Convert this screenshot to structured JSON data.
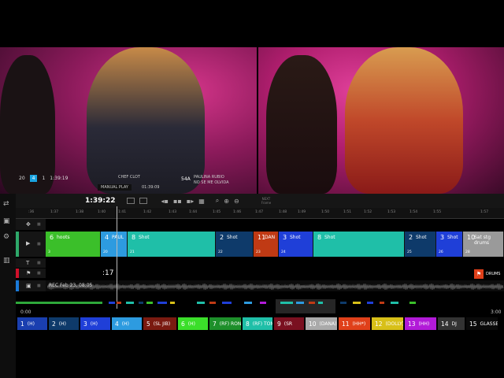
{
  "preview": {
    "left_overlay": {
      "cam_a": "20",
      "cam_b": "4",
      "cam_c": "1",
      "timecode": "1:39:19"
    },
    "left_caption_a": "CHEF CLOT",
    "left_caption_b": "MANUAL PLAY",
    "left_caption_c": "01:39:09",
    "right_caption_a": "54A",
    "right_caption_b": "PAULINA RUBIO",
    "right_caption_c": "NO SE ME OLVIDA",
    "next_label": "NEXT",
    "frame_label": "Frame"
  },
  "transport": {
    "timecode": "1:39:22"
  },
  "ruler": [
    ":36",
    "1:37",
    "1:38",
    "1:40",
    "1:41",
    "1:42",
    "1:43",
    "1:44",
    "1:45",
    "1:46",
    "1:47",
    "1:48",
    "1:49",
    "1:50",
    "1:51",
    "1:52",
    "1:53",
    "1:54",
    "1:55",
    "1:57"
  ],
  "clips": [
    {
      "num": "6",
      "label": "hoots",
      "sub": "3",
      "color": "#3bbf2a"
    },
    {
      "num": "4",
      "label": "PAUL",
      "sub": "20",
      "color": "#2d9be0"
    },
    {
      "num": "8",
      "label": "Shot",
      "sub": "21",
      "color": "#1fbfa8"
    },
    {
      "num": "2",
      "label": "Shot",
      "sub": "22",
      "color": "#0e3a6a"
    },
    {
      "num": "11",
      "label": "DAN",
      "sub": "23",
      "color": "#c03a14"
    },
    {
      "num": "3",
      "label": "Shot",
      "sub": "24",
      "color": "#1f3fd8"
    },
    {
      "num": "8",
      "label": "Shot",
      "sub": "",
      "color": "#1fbfa8"
    },
    {
      "num": "2",
      "label": "Shot",
      "sub": "25",
      "color": "#0e3a6a"
    },
    {
      "num": "3",
      "label": "Shot",
      "sub": "26",
      "color": "#1f3fd8"
    },
    {
      "num": "10",
      "label": "Sat stg drums",
      "sub": "28",
      "color": "#9a9a9a"
    }
  ],
  "markers": {
    "timecode": ":17",
    "drums": "DRUMS"
  },
  "audio": {
    "rec_label": "REC Feb 23, 08:05"
  },
  "overview": {
    "start": "0:00",
    "end": "3:00"
  },
  "cameras": [
    {
      "n": "1",
      "label": "(H)",
      "color": "#1a3fb0"
    },
    {
      "n": "2",
      "label": "(H)",
      "color": "#0e3a6a"
    },
    {
      "n": "3",
      "label": "(H)",
      "color": "#1f3fd8"
    },
    {
      "n": "4",
      "label": "(H)",
      "color": "#2d9be0"
    },
    {
      "n": "5",
      "label": "(SL JIB)",
      "color": "#7a1a10"
    },
    {
      "n": "6",
      "label": "(H)",
      "color": "#3bdf2a"
    },
    {
      "n": "7",
      "label": "(RF) RON",
      "color": "#1d8f2a"
    },
    {
      "n": "8",
      "label": "(RF) TOM",
      "color": "#1fbfa8"
    },
    {
      "n": "9",
      "label": "(SR",
      "color": "#7a1020"
    },
    {
      "n": "10",
      "label": "(DANA)",
      "color": "#aaaaaa"
    },
    {
      "n": "11",
      "label": "(HH*)",
      "color": "#e0401a"
    },
    {
      "n": "12",
      "label": "(DOLLY)",
      "color": "#d8c018"
    },
    {
      "n": "13",
      "label": "(HH)",
      "color": "#b21ad8"
    },
    {
      "n": "14",
      "label": "DJ",
      "color": "#333333"
    },
    {
      "n": "15",
      "label": "GLASSES",
      "color": "#0a0a0a"
    }
  ]
}
